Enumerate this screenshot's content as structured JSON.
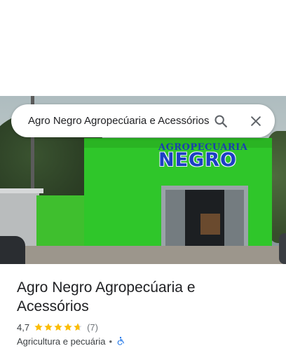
{
  "search": {
    "query": "Agro Negro Agropecúaria e Acessórios"
  },
  "photo": {
    "sign_small": "AGROPECUARIA",
    "sign_big": "NEGRO"
  },
  "place": {
    "name": "Agro Negro Agropecúaria e Acessórios",
    "rating": "4,7",
    "stars": 4.7,
    "review_count": "(7)",
    "category": "Agricultura e pecuária",
    "separator": "•"
  },
  "icons": {
    "search": "search-icon",
    "close": "close-icon",
    "star": "star-icon",
    "accessibility": "wheelchair-icon"
  },
  "colors": {
    "star": "#fbbc04",
    "accessibility": "#1a73e8"
  }
}
